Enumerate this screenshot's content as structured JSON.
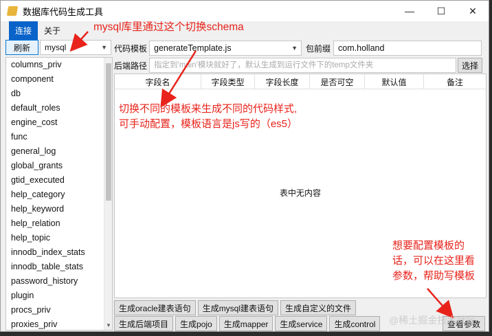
{
  "window": {
    "title": "数据库代码生成工具",
    "minimize": "—",
    "maximize": "☐",
    "close": "✕"
  },
  "menu": [
    "连接",
    "关于"
  ],
  "left": {
    "refresh_label": "刷新",
    "schema_value": "mysql",
    "tables": [
      "columns_priv",
      "component",
      "db",
      "default_roles",
      "engine_cost",
      "func",
      "general_log",
      "global_grants",
      "gtid_executed",
      "help_category",
      "help_keyword",
      "help_relation",
      "help_topic",
      "innodb_index_stats",
      "innodb_table_stats",
      "password_history",
      "plugin",
      "procs_priv",
      "proxies_priv"
    ]
  },
  "form": {
    "template_label": "代码模板",
    "template_value": "generateTemplate.js",
    "package_label": "包前缀",
    "package_value": "com.holland",
    "path_label": "后端路径",
    "path_placeholder": "指定到'main'模块就好了，默认生成到运行文件下的temp文件夹",
    "choose_label": "选择"
  },
  "table": {
    "headers": [
      "字段名",
      "字段类型",
      "字段长度",
      "是否可空",
      "默认值",
      "备注"
    ],
    "empty_text": "表中无内容"
  },
  "buttons": {
    "row1": [
      "生成oracle建表语句",
      "生成mysql建表语句",
      "生成自定义的文件"
    ],
    "row2": [
      "生成后端项目",
      "生成pojo",
      "生成mapper",
      "生成service",
      "生成control"
    ],
    "params": "查看参数"
  },
  "annotations": {
    "schema_note": "mysql库里通过这个切换schema",
    "template_note_line1": "切换不同的模板来生成不同的代码样式,",
    "template_note_line2": "可手动配置，模板语言是js写的（es5）",
    "params_note_line1": "想要配置模板的",
    "params_note_line2": "话，可以在这里看",
    "params_note_line3": "参数，帮助写模板"
  },
  "watermark": "@稀土掘金技术社区",
  "colors": {
    "accent": "#0a63c9",
    "annotation": "#e8231b"
  }
}
